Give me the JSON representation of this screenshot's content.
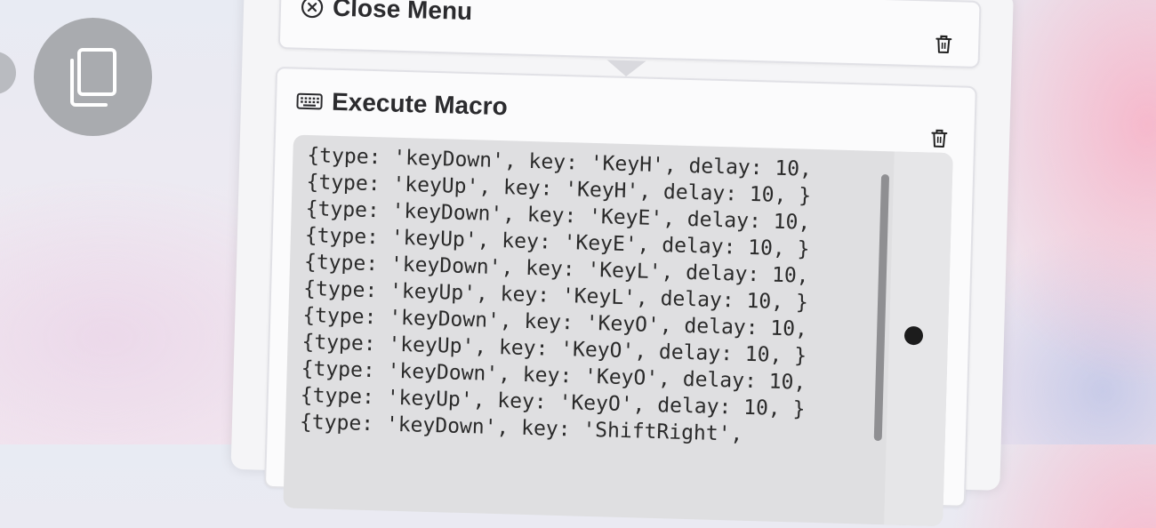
{
  "sidebar": {
    "copy_button_icon": "copy-icon"
  },
  "close_menu": {
    "title": "Close Menu",
    "icon": "close-circle-icon",
    "delete_icon": "trash-icon"
  },
  "execute_macro": {
    "title": "Execute Macro",
    "icon": "keyboard-icon",
    "delete_icon": "trash-icon",
    "code_lines": [
      "{type: 'keyDown', key: 'KeyH', delay: 10,",
      "{type: 'keyUp', key: 'KeyH', delay: 10, }",
      "{type: 'keyDown', key: 'KeyE', delay: 10,",
      "{type: 'keyUp', key: 'KeyE', delay: 10, }",
      "{type: 'keyDown', key: 'KeyL', delay: 10,",
      "{type: 'keyUp', key: 'KeyL', delay: 10, }",
      "{type: 'keyDown', key: 'KeyO', delay: 10,",
      "{type: 'keyUp', key: 'KeyO', delay: 10, }",
      "{type: 'keyDown', key: 'KeyO', delay: 10,",
      "{type: 'keyUp', key: 'KeyO', delay: 10, }",
      "{type: 'keyDown', key: 'ShiftRight',"
    ]
  }
}
